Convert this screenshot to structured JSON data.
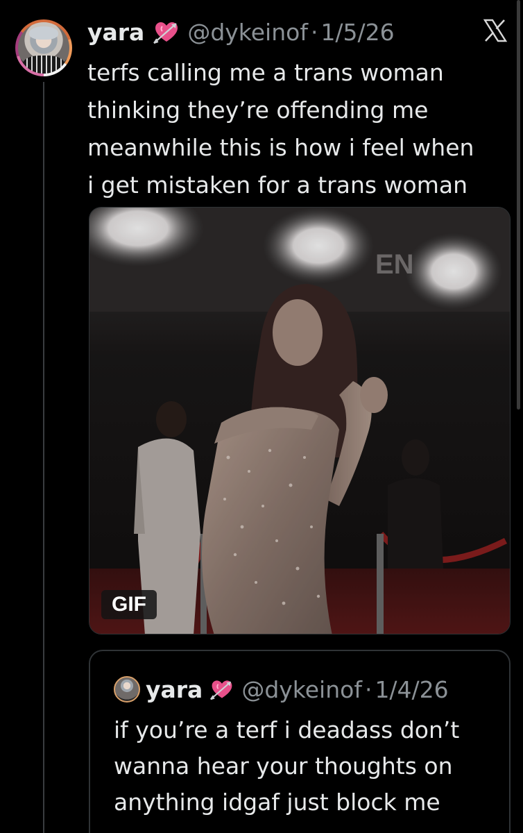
{
  "post": {
    "name": "yara",
    "handle": "@dykeinof",
    "separator": "·",
    "date": "1/5/26",
    "badge_icon": "heart-with-arrow-icon",
    "platform_icon": "x-logo-icon",
    "text_lines": [
      "terfs calling me a trans woman",
      "thinking they’re offending me",
      "meanwhile this is how i feel when",
      "i get mistaken for a trans woman"
    ],
    "media_badge": "GIF"
  },
  "quoted": {
    "name": "yara",
    "handle": "@dykeinof",
    "separator": "·",
    "date": "1/4/26",
    "badge_icon": "heart-with-arrow-icon",
    "text_lines": [
      "if you’re a terf i deadass don’t",
      "wanna hear your thoughts on",
      "anything idgaf just block me"
    ]
  },
  "colors": {
    "background": "#000000",
    "text": "#e7e9ea",
    "secondary_text": "#8b9196",
    "border": "#2f3336",
    "heart": "#e8508a"
  }
}
